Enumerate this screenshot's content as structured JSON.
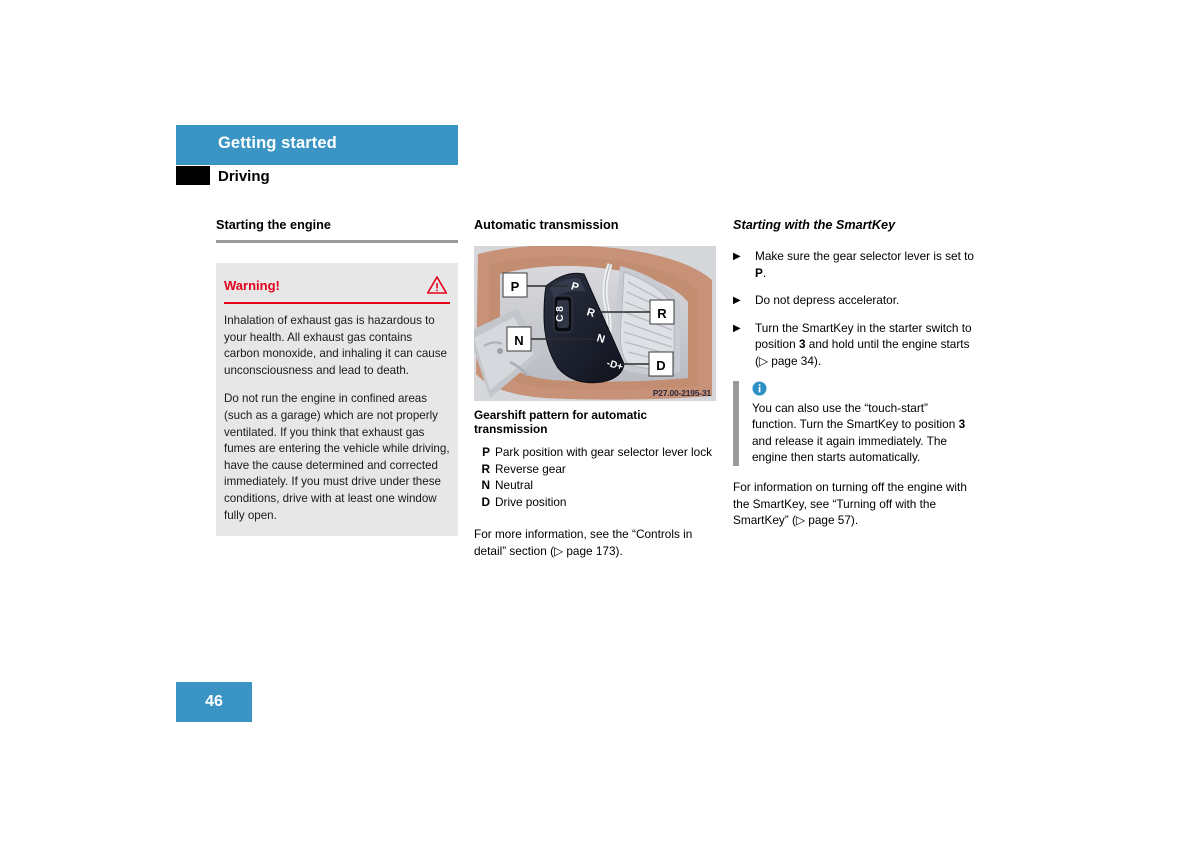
{
  "header": {
    "section_title": "Getting started",
    "subsection_title": "Driving",
    "accent_color": "#3a95c5"
  },
  "left_column": {
    "heading": "Starting the engine",
    "warning": {
      "title": "Warning!",
      "icon": "warning-triangle-icon",
      "accent_color": "#e3001b",
      "background_color": "#e7e7e7",
      "paragraph_1": "Inhalation of exhaust gas is hazardous to your health. All exhaust gas contains carbon monoxide, and inhaling it can cause unconsciousness and lead to death.",
      "paragraph_2": "Do not run the engine in confined areas (such as a garage) which are not properly ventilated. If you think that exhaust gas fumes are entering the vehicle while driving, have the cause determined and corrected immediately. If you must drive under these conditions, drive with at least one window fully open."
    }
  },
  "middle_column": {
    "heading": "Automatic transmission",
    "figure": {
      "code": "P27.00-2195-31",
      "callouts": [
        "P",
        "R",
        "N",
        "D"
      ],
      "lever_labels": [
        "P",
        "R",
        "N",
        "-D+"
      ]
    },
    "figure_caption": "Gearshift pattern for automatic transmission",
    "legend": [
      {
        "key": "P",
        "desc": "Park position with gear selector lever lock"
      },
      {
        "key": "R",
        "desc": "Reverse gear"
      },
      {
        "key": "N",
        "desc": "Neutral"
      },
      {
        "key": "D",
        "desc": "Drive position"
      }
    ],
    "more_info": "For more information, see the “Controls in detail” section (▷ page 173)."
  },
  "right_column": {
    "heading": "Starting with the SmartKey",
    "steps": [
      {
        "marker": "▶",
        "text_before": "Make sure the gear selector lever is set to ",
        "bold": "P",
        "text_after": "."
      },
      {
        "marker": "▶",
        "text_before": "Do not depress accelerator.",
        "bold": "",
        "text_after": ""
      },
      {
        "marker": "▶",
        "text_before": "Turn the SmartKey in the starter switch to position ",
        "bold": "3",
        "text_after": " and hold until the engine starts (▷ page 34)."
      }
    ],
    "note": {
      "icon": "info-circle-icon",
      "bar_color": "#9a9a9a",
      "text_before": "You can also use the “touch-start” function. Turn the SmartKey to position ",
      "bold": "3",
      "text_after": " and release it again immediately. The engine then starts automatically."
    },
    "closing_paragraph": "For information on turning off the engine with the SmartKey, see “Turning off with the SmartKey” (▷ page 57)."
  },
  "footer": {
    "page_number": "46"
  }
}
